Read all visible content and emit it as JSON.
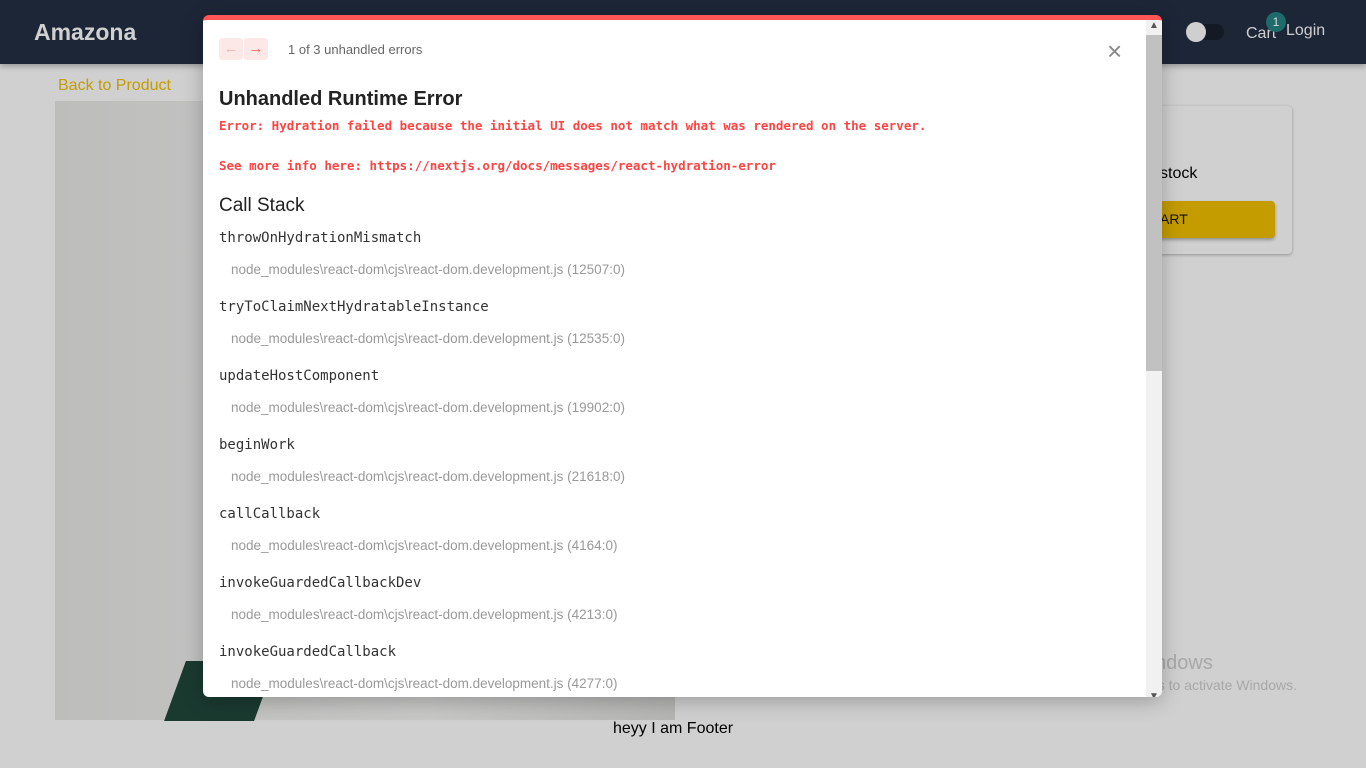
{
  "header": {
    "brand": "Amazona",
    "cart": "Cart",
    "cart_count": "1",
    "login": "Login"
  },
  "page": {
    "back_link": "Back to Product",
    "card_line1": ")",
    "card_line2": "stock",
    "card_button": "ART",
    "footer": "heyy I am Footer"
  },
  "watermark": {
    "title": "Activate Windows",
    "subtitle": "Go to PC settings to activate Windows."
  },
  "error_overlay": {
    "prev_icon": "←",
    "next_icon": "→",
    "count": "1 of 3 unhandled errors",
    "close_icon": "×",
    "title": "Unhandled Runtime Error",
    "message": "Error: Hydration failed because the initial UI does not match what was rendered on the server.\n\nSee more info here: https://nextjs.org/docs/messages/react-hydration-error",
    "call_stack_title": "Call Stack",
    "frames": [
      {
        "fn": "throwOnHydrationMismatch",
        "loc": "node_modules\\react-dom\\cjs\\react-dom.development.js (12507:0)"
      },
      {
        "fn": "tryToClaimNextHydratableInstance",
        "loc": "node_modules\\react-dom\\cjs\\react-dom.development.js (12535:0)"
      },
      {
        "fn": "updateHostComponent",
        "loc": "node_modules\\react-dom\\cjs\\react-dom.development.js (19902:0)"
      },
      {
        "fn": "beginWork",
        "loc": "node_modules\\react-dom\\cjs\\react-dom.development.js (21618:0)"
      },
      {
        "fn": "callCallback",
        "loc": "node_modules\\react-dom\\cjs\\react-dom.development.js (4164:0)"
      },
      {
        "fn": "invokeGuardedCallbackDev",
        "loc": "node_modules\\react-dom\\cjs\\react-dom.development.js (4213:0)"
      },
      {
        "fn": "invokeGuardedCallback",
        "loc": "node_modules\\react-dom\\cjs\\react-dom.development.js (4277:0)"
      }
    ]
  },
  "colors": {
    "accent": "#ff5555",
    "brand_yellow": "#c49c00",
    "header_bg": "#1c2636"
  }
}
